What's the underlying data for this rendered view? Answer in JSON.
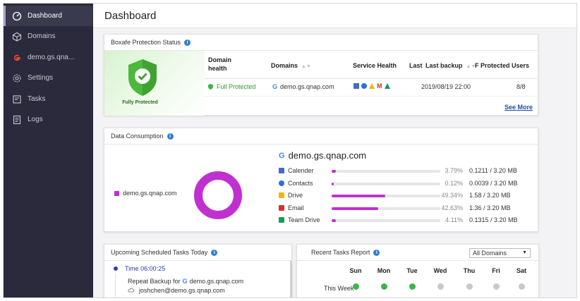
{
  "sidebar": {
    "items": [
      {
        "label": "Dashboard",
        "icon": "dashboard-icon"
      },
      {
        "label": "Domains",
        "icon": "domains-icon"
      },
      {
        "label": "demo.gs.qnap.com",
        "display": "demo.gs.qna...",
        "icon": "google-icon"
      },
      {
        "label": "Settings",
        "icon": "gear-icon"
      },
      {
        "label": "Tasks",
        "icon": "tasks-icon"
      },
      {
        "label": "Logs",
        "icon": "logs-icon"
      }
    ]
  },
  "header": {
    "title": "Dashboard"
  },
  "protection": {
    "title": "Boxafe Protection Status",
    "badge_text": "Fully Protected",
    "columns": {
      "domain_health": "Domain health",
      "domains": "Domains",
      "service_health": "Service Health",
      "last": "Last",
      "last_backup": "Last backup",
      "protected_users": "F Protected Users"
    },
    "row": {
      "health": "Full Protected",
      "domain": "demo.gs.qnap.com",
      "last_backup": "2019/08/19 22:00",
      "protected_users": "8/8"
    },
    "see_more": "See More"
  },
  "consumption": {
    "title": "Data Consumption",
    "legend_label": "demo.gs.qnap.com",
    "domain_title": "demo.gs.qnap.com",
    "accent": "#c030d0",
    "categories": [
      {
        "name": "Calender",
        "icon": "calendar-icon",
        "percent": "3.79%",
        "fraction": 0.0379,
        "usage": "0.1211 / 3.20 MB"
      },
      {
        "name": "Contacts",
        "icon": "contacts-icon",
        "percent": "0.12%",
        "fraction": 0.0012,
        "usage": "0.0039 / 3.20 MB"
      },
      {
        "name": "Drive",
        "icon": "drive-icon",
        "percent": "49.34%",
        "fraction": 0.4934,
        "usage": "1.58 / 3.20 MB"
      },
      {
        "name": "Email",
        "icon": "email-icon",
        "percent": "42.63%",
        "fraction": 0.4263,
        "usage": "1.36 / 3.20 MB"
      },
      {
        "name": "Team Drive",
        "icon": "team-drive-icon",
        "percent": "4.11%",
        "fraction": 0.0411,
        "usage": "0.1315 / 3.20 MB"
      }
    ]
  },
  "upcoming": {
    "title": "Upcoming Scheduled Tasks Today",
    "time": "Time 06:00:25",
    "task_prefix": "Repeat Backup for",
    "task_domain": "demo.gs.qnap.com",
    "task_user": "joshchen@demo.gs.qnap.com"
  },
  "recent": {
    "title": "Recent Tasks Report",
    "filter": "All Domains",
    "days": [
      "Sun",
      "Mon",
      "Tue",
      "Wed",
      "Thu",
      "Fri",
      "Sat"
    ],
    "this_week_label": "This Week",
    "this_week": [
      "ok",
      "ok",
      "ok",
      "none",
      "none",
      "none",
      "none"
    ],
    "next_row": [
      "ok",
      "ok",
      "ok",
      "ok",
      "ok",
      "ok",
      "ok"
    ]
  }
}
